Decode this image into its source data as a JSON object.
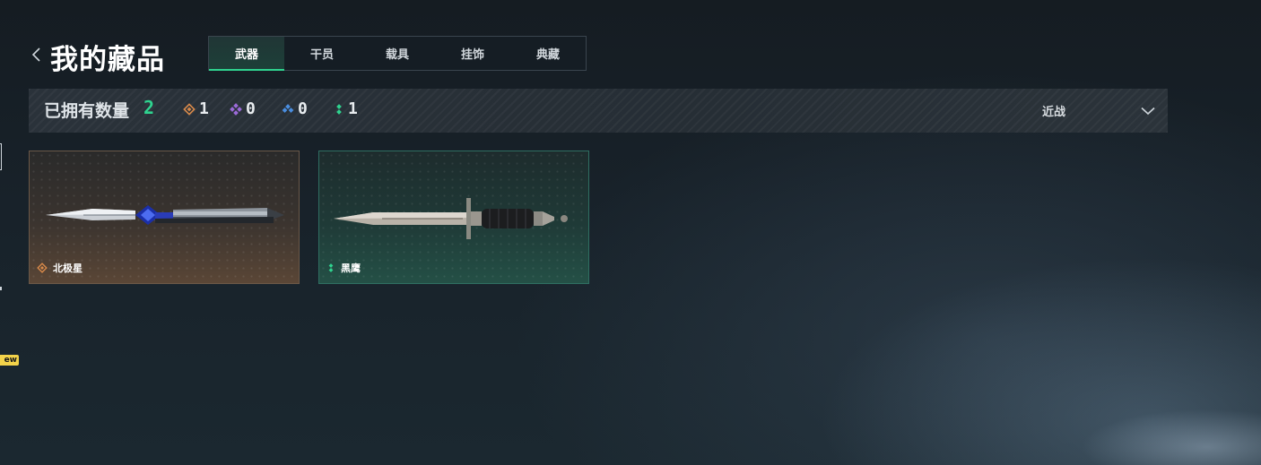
{
  "header": {
    "title": "我的藏品"
  },
  "tabs": [
    {
      "label": "武器",
      "active": true
    },
    {
      "label": "干员",
      "active": false
    },
    {
      "label": "载具",
      "active": false
    },
    {
      "label": "挂饰",
      "active": false
    },
    {
      "label": "典藏",
      "active": false
    }
  ],
  "stats": {
    "owned_label": "已拥有数量",
    "owned_count": "2",
    "rarities": [
      {
        "icon": "gold-diamond-icon",
        "color": "#d98a4a",
        "count": "1"
      },
      {
        "icon": "purple-diamond-icon",
        "color": "#9b6ad8",
        "count": "0"
      },
      {
        "icon": "blue-diamond-icon",
        "color": "#4a8ee0",
        "count": "0"
      },
      {
        "icon": "green-dots-icon",
        "color": "#2fd38f",
        "count": "1"
      }
    ],
    "filter": {
      "selected": "近战"
    }
  },
  "items": [
    {
      "name": "北极星",
      "rarity": "gold",
      "rarity_color": "#d98a4a"
    },
    {
      "name": "黑鹰",
      "rarity": "green",
      "rarity_color": "#2fd38f"
    }
  ],
  "edge": {
    "badge": "New"
  },
  "colors": {
    "accent": "#2fd38f",
    "gold": "#d98a4a",
    "purple": "#9b6ad8",
    "blue": "#4a8ee0"
  }
}
